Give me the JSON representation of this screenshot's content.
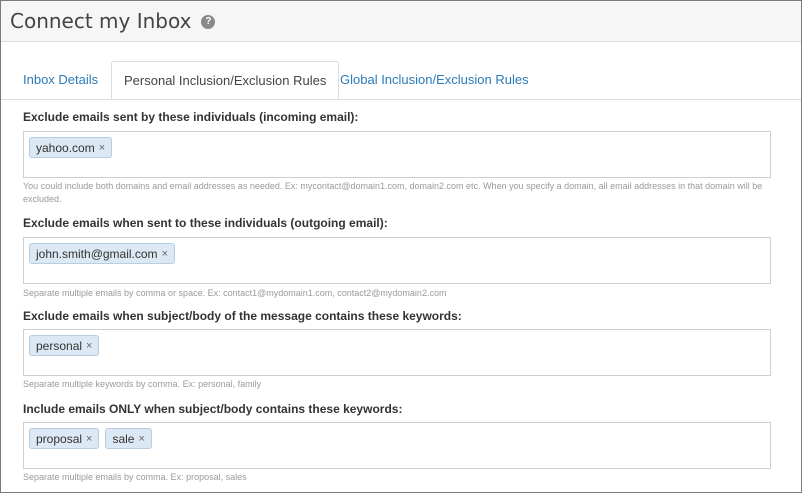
{
  "page": {
    "title": "Connect my Inbox",
    "help_icon": "?"
  },
  "tabs": [
    {
      "label": "Inbox Details",
      "active": false
    },
    {
      "label": "Personal Inclusion/Exclusion Rules",
      "active": true
    },
    {
      "label": "Global Inclusion/Exclusion Rules",
      "active": false
    }
  ],
  "sections": [
    {
      "label": "Exclude emails sent by these individuals (incoming email):",
      "tags": [
        "yahoo.com"
      ],
      "help": "You could include both domains and email addresses as needed. Ex: mycontact@domain1.com, domain2.com etc. When you specify a domain, all email addresses in that domain will be excluded."
    },
    {
      "label": "Exclude emails when sent to these individuals (outgoing email):",
      "tags": [
        "john.smith@gmail.com"
      ],
      "help": "Separate multiple emails by comma or space. Ex: contact1@mydomain1.com, contact2@mydomain2.com"
    },
    {
      "label": "Exclude emails when subject/body of the message contains these keywords:",
      "tags": [
        "personal"
      ],
      "help": "Separate multiple keywords by comma. Ex: personal, family"
    },
    {
      "label": "Include emails ONLY when subject/body contains these keywords:",
      "tags": [
        "proposal",
        "sale"
      ],
      "help": "Separate multiple emails by comma. Ex: proposal, sales"
    }
  ],
  "tag_remove_glyph": "×",
  "colors": {
    "link": "#2b7bb9",
    "tag_bg": "#dce8f3",
    "tag_border": "#b7cde2"
  }
}
